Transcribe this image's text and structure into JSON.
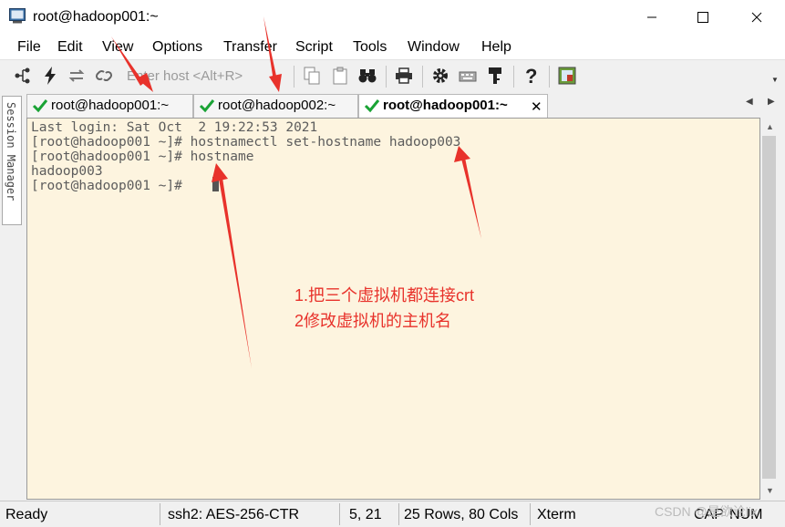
{
  "window": {
    "title": "root@hadoop001:~",
    "controls": [
      "minimize",
      "maximize",
      "close"
    ]
  },
  "menu": [
    "File",
    "Edit",
    "View",
    "Options",
    "Transfer",
    "Script",
    "Tools",
    "Window",
    "Help"
  ],
  "toolbar": {
    "host_placeholder": "Enter host <Alt+R>"
  },
  "sidebar": {
    "session_manager_label": "Session Manager"
  },
  "tabs": [
    {
      "label": "root@hadoop001:~",
      "connected": true,
      "active": false
    },
    {
      "label": "root@hadoop002:~",
      "connected": true,
      "active": false
    },
    {
      "label": "root@hadoop001:~",
      "connected": true,
      "active": true
    }
  ],
  "terminal": {
    "lines": [
      "Last login: Sat Oct  2 19:22:53 2021",
      "[root@hadoop001 ~]# hostnamectl set-hostname hadoop003",
      "[root@hadoop001 ~]# hostname",
      "hadoop003",
      "[root@hadoop001 ~]# "
    ]
  },
  "annotation": {
    "line1": "1.把三个虚拟机都连接crt",
    "line2": "2修改虚拟机的主机名"
  },
  "status": {
    "state": "Ready",
    "cipher": "ssh2: AES-256-CTR",
    "cursor_pos": "5, 21",
    "dimensions": "25 Rows, 80 Cols",
    "terminal_type": "Xterm",
    "caps": "CAP",
    "num": "NUM"
  },
  "watermark": "CSDN @是欲论lix",
  "colors": {
    "terminal_bg": "#fdf4df",
    "terminal_text": "#5c5c5c",
    "annotation": "#e8322b",
    "check": "#1aa335"
  }
}
